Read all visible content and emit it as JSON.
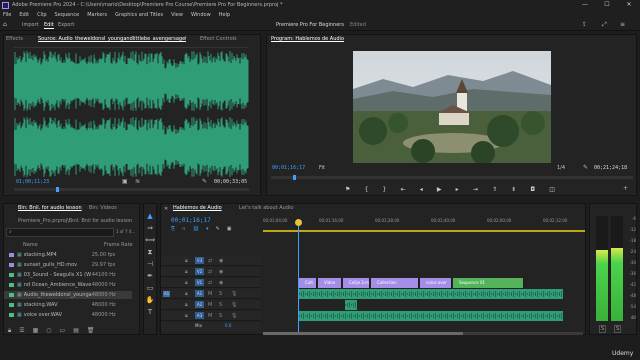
{
  "titlebar": {
    "title": "Adobe Premiere Pro 2024 - C:\\Users\\mario\\Desktop\\Premiere Pro Course\\Premiere Pro For Beginners.prproj *",
    "minimize": "—",
    "maximize": "☐",
    "close": "✕"
  },
  "menu": [
    "File",
    "Edit",
    "Clip",
    "Sequence",
    "Markers",
    "Graphics and Titles",
    "View",
    "Window",
    "Help"
  ],
  "workspace": {
    "tabs": [
      "Import",
      "Edit",
      "Export"
    ],
    "active": "Edit",
    "project_title": "Premiere Pro For Beginners",
    "project_state": "Edited"
  },
  "source": {
    "tabs": [
      "Effects",
      "Source: Audio_theweldonsl_youngandlittlebe_avengersagethere.wav",
      "Effect Controls"
    ],
    "timecode": "01;00;11;23",
    "duration": "00;00;33;05"
  },
  "program": {
    "tab": "Program: Hablemos de Audio",
    "timecode": "00;01;16;17",
    "fit": "Fit",
    "resolution": "1/4",
    "duration": "00;21;24;18"
  },
  "project": {
    "tabs": [
      "Bin: Bnil. for audio lesson",
      "Bin: Videos"
    ],
    "path": "Premiere_Pro.prproj\\Bnil: Bnil for audio lesson",
    "count": "1 of 7 it...",
    "col_name": "Name",
    "col_framerate": "Frame Rate",
    "items": [
      {
        "name": "stacking.MP4",
        "fr": "25.00 fps",
        "color": "#9d8de0"
      },
      {
        "name": "sunset_gulls_HD.mov",
        "fr": "29.97 fps",
        "color": "#9d8de0"
      },
      {
        "name": "03_Sound - Seagulls X1 (W",
        "fr": "44100 Hz",
        "color": "#4fbf7f"
      },
      {
        "name": "nd Ocean_Ambience_Wave",
        "fr": "48000 Hz",
        "color": "#4fbf7f"
      },
      {
        "name": "Audio_theweldonsl_youngan",
        "fr": "48000 Hz",
        "color": "#4fbf7f"
      },
      {
        "name": "stacking.WAV",
        "fr": "48000 Hz",
        "color": "#4fbf7f"
      },
      {
        "name": "voice over.WAV",
        "fr": "48000 Hz",
        "color": "#4fbf7f"
      }
    ]
  },
  "timeline": {
    "tabs": [
      "Hablemos de Audio",
      "Let's talk about Audio"
    ],
    "timecode": "00;01;16;17",
    "ruler": [
      "00;01;04;00",
      "00;01;16;00",
      "00;01;28;00",
      "00;01;40;00",
      "00;02;00;00",
      "00;02;12;00"
    ],
    "video_tracks": [
      "V3",
      "V2",
      "V1"
    ],
    "audio_tracks": [
      "A1",
      "A2",
      "A3"
    ],
    "master_label": "Mix",
    "master_value": "0.0",
    "video_clips": [
      "Colt",
      "Video",
      "Collje 3.m",
      "Collection",
      "voice over",
      "Sequence 01"
    ]
  },
  "meters": {
    "labels": [
      "-6",
      "-12",
      "-18",
      "-24",
      "-30",
      "-36",
      "-42",
      "-48",
      "-54",
      "dB"
    ],
    "solo": [
      "S",
      "S"
    ],
    "level_left": 0.68,
    "level_right": 0.7
  },
  "watermark": "Udemy",
  "colors": {
    "accent": "#3fa0ff",
    "waveform": "#2f9e77",
    "video_clip": "#a58ee8",
    "audio_clip": "#2f9e77",
    "meter": "#4bd34b"
  }
}
